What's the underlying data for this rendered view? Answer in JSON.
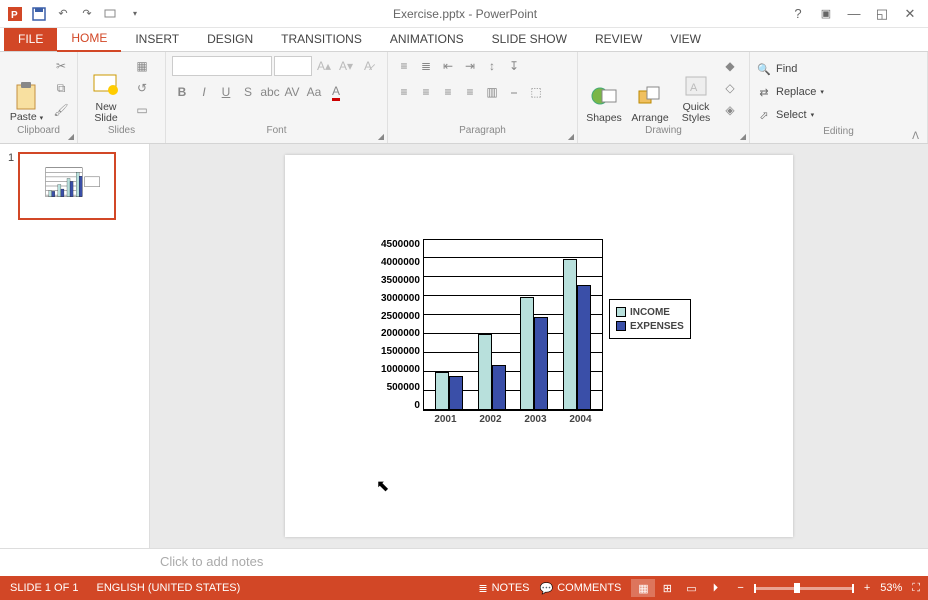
{
  "title": "Exercise.pptx - PowerPoint",
  "tabs": {
    "file": "FILE",
    "home": "HOME",
    "insert": "INSERT",
    "design": "DESIGN",
    "transitions": "TRANSITIONS",
    "animations": "ANIMATIONS",
    "slideshow": "SLIDE SHOW",
    "review": "REVIEW",
    "view": "VIEW"
  },
  "ribbon": {
    "clipboard": {
      "label": "Clipboard",
      "paste": "Paste"
    },
    "slides": {
      "label": "Slides",
      "new_slide": "New\nSlide"
    },
    "font": {
      "label": "Font"
    },
    "paragraph": {
      "label": "Paragraph"
    },
    "drawing": {
      "label": "Drawing",
      "shapes": "Shapes",
      "arrange": "Arrange",
      "quick": "Quick\nStyles"
    },
    "editing": {
      "label": "Editing",
      "find": "Find",
      "replace": "Replace",
      "select": "Select"
    }
  },
  "notes_placeholder": "Click to add notes",
  "status": {
    "slide": "SLIDE 1 OF 1",
    "lang": "ENGLISH (UNITED STATES)",
    "notes": "NOTES",
    "comments": "COMMENTS",
    "zoom": "53%"
  },
  "chart_data": {
    "type": "bar",
    "categories": [
      "2001",
      "2002",
      "2003",
      "2004"
    ],
    "series": [
      {
        "name": "INCOME",
        "values": [
          1000000,
          2000000,
          3000000,
          4000000
        ]
      },
      {
        "name": "EXPENSES",
        "values": [
          900000,
          1200000,
          2450000,
          3300000
        ]
      }
    ],
    "ylim": [
      0,
      4500000
    ],
    "yticks": [
      "4500000",
      "4000000",
      "3500000",
      "3000000",
      "2500000",
      "2000000",
      "1500000",
      "1000000",
      "500000",
      "0"
    ],
    "legend": [
      "INCOME",
      "EXPENSES"
    ]
  }
}
